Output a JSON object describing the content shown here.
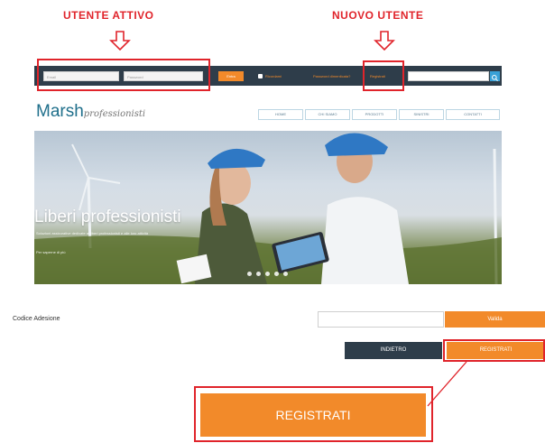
{
  "annotations": {
    "utente_attivo": "UTENTE ATTIVO",
    "nuovo_utente": "NUOVO UTENTE"
  },
  "topbar": {
    "email_placeholder": "Email",
    "password_placeholder": "Password",
    "login_label": "Entra",
    "remember_label": "Ricordami",
    "forgot_label": "Password dimenticata?",
    "register_label": "Registrati",
    "search_placeholder": ""
  },
  "logo": {
    "main": "Marsh",
    "sub": "professionisti"
  },
  "nav": {
    "items": [
      "HOME",
      "CHI SIAMO",
      "PRODOTTI",
      "SINISTRI",
      "CONTATTI"
    ]
  },
  "hero": {
    "title": "Liberi professionisti",
    "subtitle": "Soluzioni assicurative dedicate ai liberi professionisti e alle loro attività",
    "link": "Per saperne di più"
  },
  "form": {
    "code_label": "Codice Adesione",
    "code_value": "",
    "validate_label": "Valida",
    "back_label": "INDIETRO",
    "register_label": "REGISTRATI"
  },
  "zoom": {
    "register_label": "REGISTRATI"
  },
  "colors": {
    "accent": "#f28a2a",
    "annotation_red": "#e0242b",
    "topbar_bg": "#2e3d4a",
    "logo_blue": "#1f6f8b"
  }
}
